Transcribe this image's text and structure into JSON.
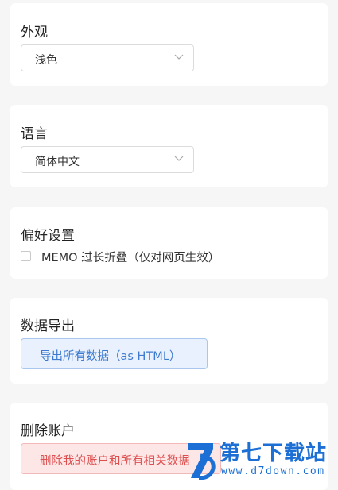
{
  "appearance": {
    "title": "外观",
    "selected": "浅色"
  },
  "language": {
    "title": "语言",
    "selected": "简体中文"
  },
  "preferences": {
    "title": "偏好设置",
    "memo_collapse_label": "MEMO 过长折叠（仅对网页生效）",
    "memo_collapse_checked": false
  },
  "export": {
    "title": "数据导出",
    "button_label": "导出所有数据（as HTML）"
  },
  "delete_account": {
    "title": "删除账户",
    "button_label": "删除我的账户和所有相关数据"
  },
  "watermark": {
    "name": "第七下载站",
    "url": "www.d7down.com"
  },
  "colors": {
    "page_background": "#f6f6f6",
    "card_background": "#ffffff",
    "export_button_bg": "#e8f1fd",
    "export_button_text": "#3d7ad0",
    "delete_button_bg": "#fde6e6",
    "delete_button_text": "#dd4e4e",
    "watermark_blue": "#1c6fd4"
  }
}
